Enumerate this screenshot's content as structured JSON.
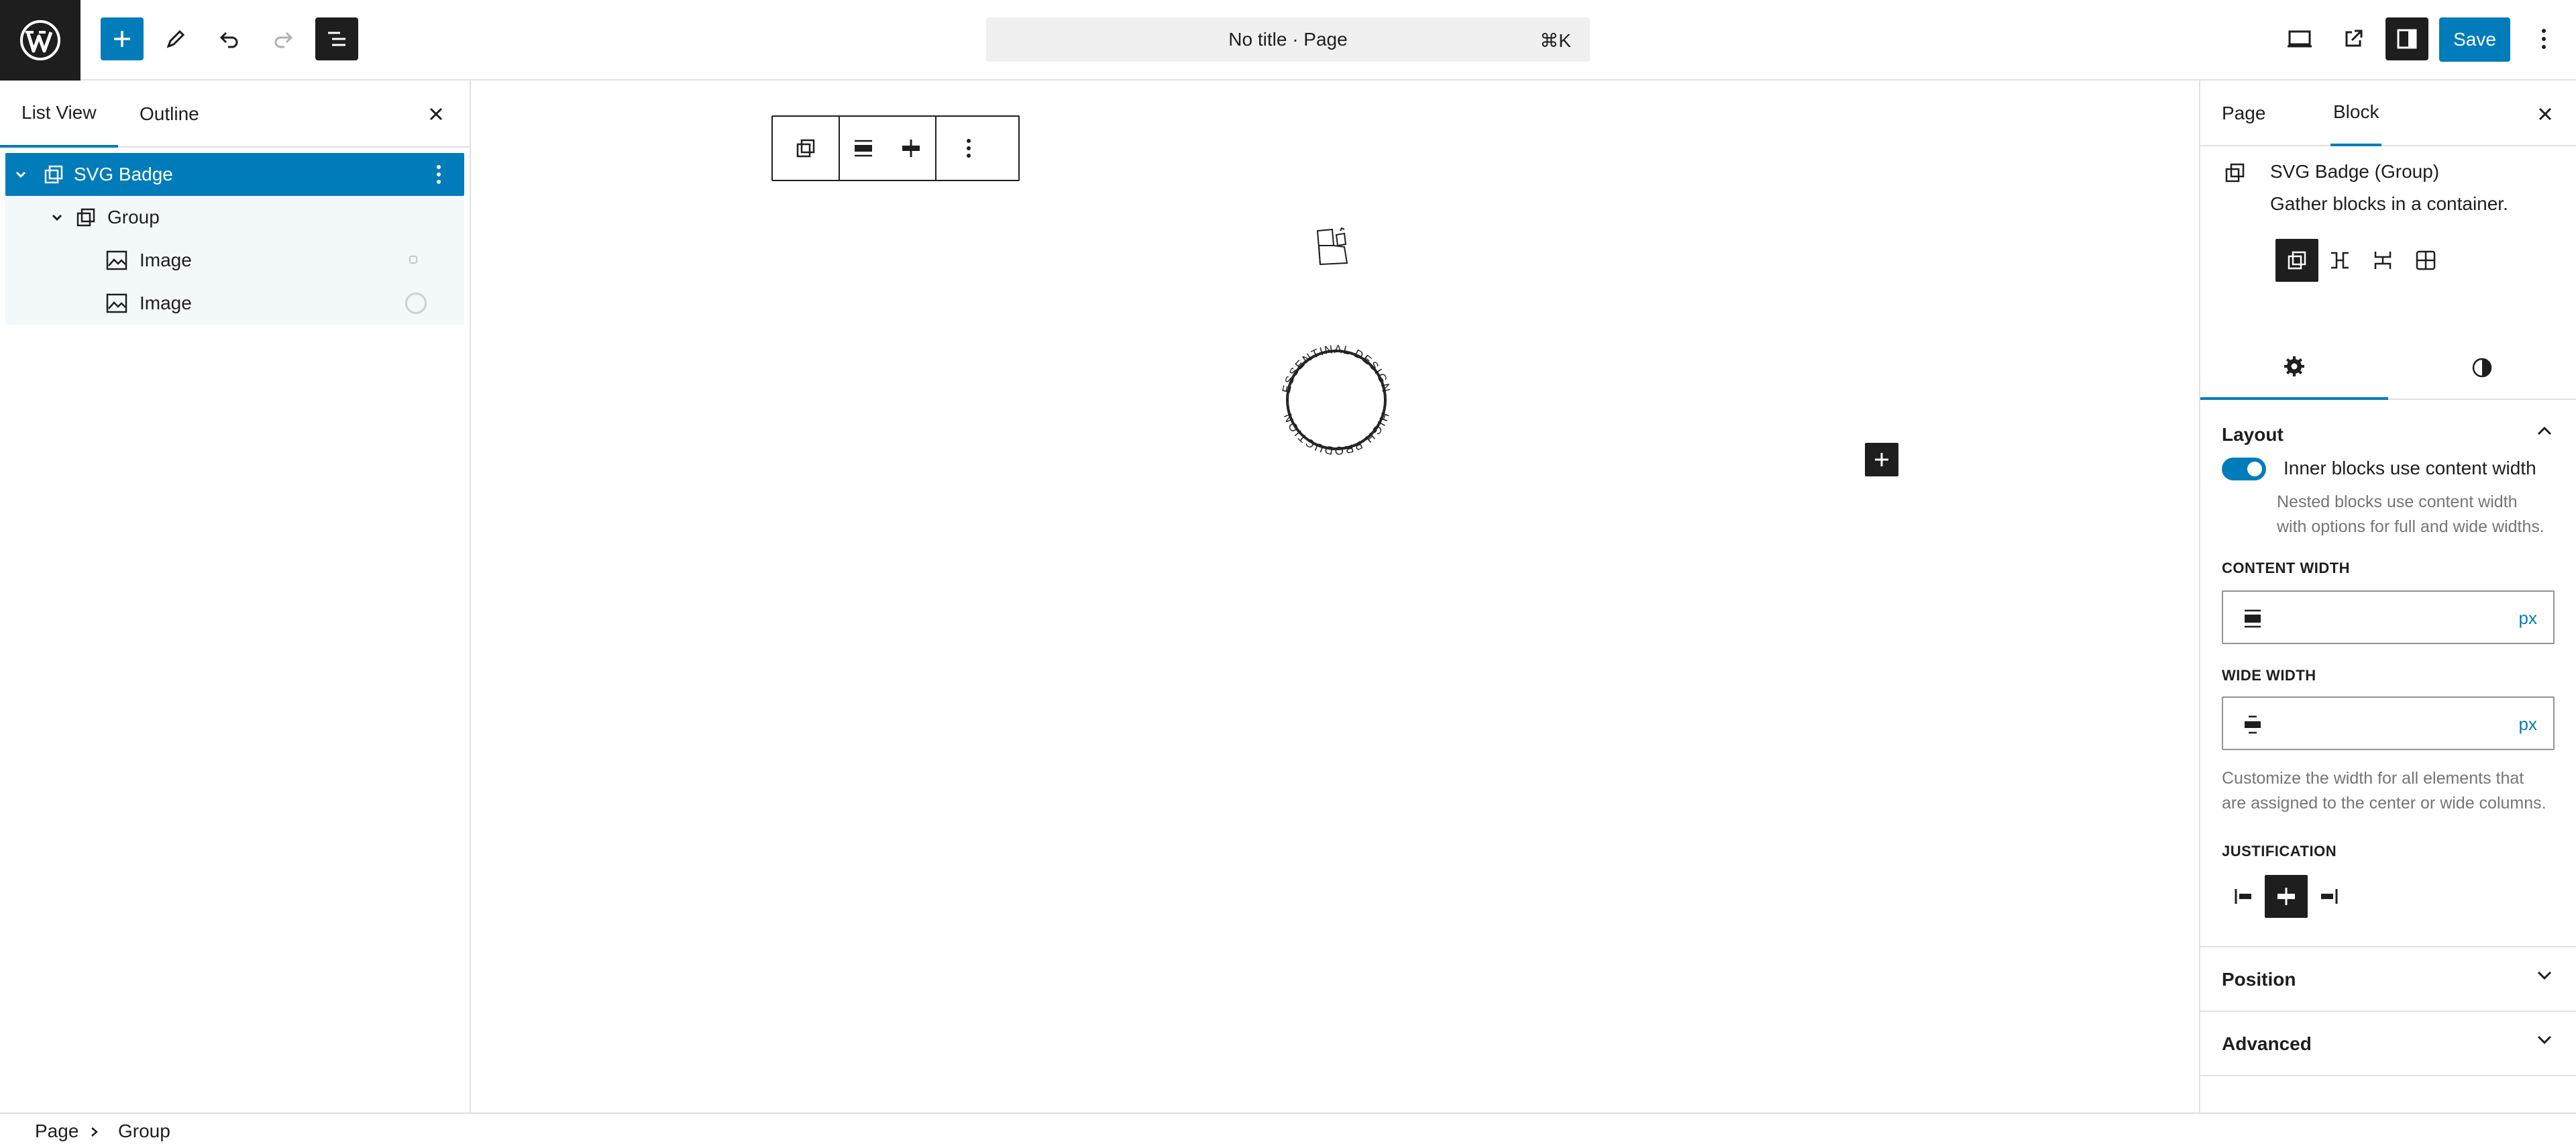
{
  "topbar": {
    "document_title": "No title · Page",
    "shortcut": "⌘K",
    "save_label": "Save",
    "accent": "#007cba"
  },
  "list_view": {
    "tabs": [
      {
        "label": "List View",
        "active": true
      },
      {
        "label": "Outline",
        "active": false
      }
    ],
    "items": [
      {
        "label": "SVG Badge",
        "icon": "group-icon",
        "selected": true
      },
      {
        "label": "Group",
        "icon": "group-icon"
      },
      {
        "label": "Image",
        "icon": "image-icon"
      },
      {
        "label": "Image",
        "icon": "image-icon"
      }
    ]
  },
  "canvas": {
    "badge_text_top": "ESSENTINAL DESIGN",
    "badge_text_bottom": "HIGH PRODUCTION"
  },
  "sidebar": {
    "tabs": [
      {
        "label": "Page",
        "active": false
      },
      {
        "label": "Block",
        "active": true
      }
    ],
    "block_title": "SVG Badge (Group)",
    "block_description": "Gather blocks in a container.",
    "layout": {
      "title": "Layout",
      "toggle_label": "Inner blocks use content width",
      "toggle_on": true,
      "toggle_help": [
        "Nested blocks use content width",
        "with options for full and wide widths."
      ],
      "content_width_label": "CONTENT WIDTH",
      "content_width_value": "",
      "content_width_unit": "px",
      "wide_width_label": "WIDE WIDTH",
      "wide_width_value": "",
      "wide_width_unit": "px",
      "width_help": [
        "Customize the width for all elements that",
        "are assigned to the center or wide columns."
      ],
      "justification_label": "JUSTIFICATION",
      "justification_selected": "center"
    },
    "position_title": "Position",
    "advanced_title": "Advanced"
  },
  "breadcrumb": [
    "Page",
    "Group"
  ]
}
